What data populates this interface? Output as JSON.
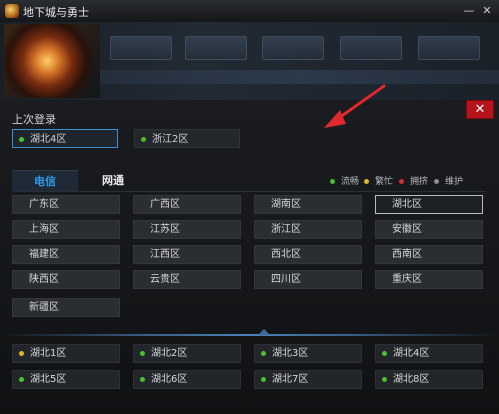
{
  "window": {
    "title": "地下城与勇士",
    "min_icon": "minimize-icon",
    "close_icon": "close-icon"
  },
  "panel": {
    "close_label": "✕",
    "recent_title": "上次登录",
    "recent": [
      {
        "label": "湖北4区",
        "status": "green",
        "selected": true
      },
      {
        "label": "浙江2区",
        "status": "green",
        "selected": false
      }
    ],
    "tabs": [
      {
        "label": "电信",
        "active": true
      },
      {
        "label": "网通",
        "active": false
      }
    ],
    "legend": [
      {
        "label": "流畅",
        "color": "#4bbf2e"
      },
      {
        "label": "繁忙",
        "color": "#e4b223"
      },
      {
        "label": "拥挤",
        "color": "#d43131"
      },
      {
        "label": "维护",
        "color": "#8a8f96"
      }
    ],
    "servers": [
      [
        "广东区",
        "广西区",
        "湖南区",
        "湖北区"
      ],
      [
        "上海区",
        "江苏区",
        "浙江区",
        "安徽区"
      ],
      [
        "福建区",
        "江西区",
        "西北区",
        "西南区"
      ],
      [
        "陕西区",
        "云贵区",
        "四川区",
        "重庆区"
      ],
      [
        "新疆区"
      ]
    ],
    "selected_server": "湖北区",
    "subservers": [
      {
        "label": "湖北1区",
        "status": "yellow"
      },
      {
        "label": "湖北2区",
        "status": "green"
      },
      {
        "label": "湖北3区",
        "status": "green"
      },
      {
        "label": "湖北4区",
        "status": "green"
      },
      {
        "label": "湖北5区",
        "status": "green"
      },
      {
        "label": "湖北6区",
        "status": "green"
      },
      {
        "label": "湖北7区",
        "status": "green"
      },
      {
        "label": "湖北8区",
        "status": "green"
      }
    ],
    "annotation_arrow_color": "#e0282f"
  }
}
